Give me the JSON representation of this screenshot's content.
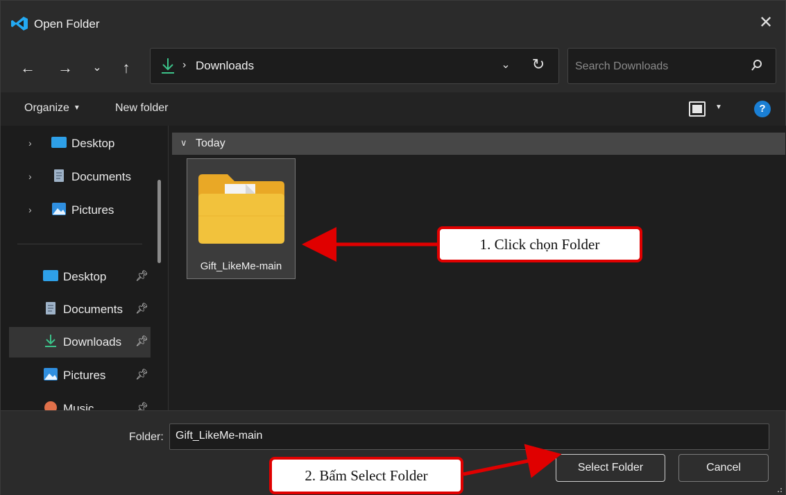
{
  "window": {
    "title": "Open Folder"
  },
  "nav": {
    "back_icon": "arrow-left-icon",
    "forward_icon": "arrow-right-icon",
    "recent_icon": "chevron-down-icon",
    "up_icon": "arrow-up-icon",
    "path_current": "Downloads",
    "refresh_icon": "refresh-icon",
    "search_placeholder": "Search Downloads"
  },
  "toolbar": {
    "organize_label": "Organize",
    "new_folder_label": "New folder",
    "help_label": "?"
  },
  "sidebar": {
    "tree": [
      {
        "label": "Desktop",
        "icon": "desktop-icon"
      },
      {
        "label": "Documents",
        "icon": "documents-icon"
      },
      {
        "label": "Pictures",
        "icon": "pictures-icon"
      }
    ],
    "quick_access": [
      {
        "label": "Desktop",
        "icon": "desktop-icon",
        "pinned": true
      },
      {
        "label": "Documents",
        "icon": "documents-icon",
        "pinned": true
      },
      {
        "label": "Downloads",
        "icon": "download-icon",
        "pinned": true,
        "selected": true
      },
      {
        "label": "Pictures",
        "icon": "pictures-icon",
        "pinned": true
      },
      {
        "label": "Music",
        "icon": "music-icon",
        "pinned": true
      }
    ]
  },
  "content": {
    "group_label": "Today",
    "items": [
      {
        "name": "Gift_LikeMe-main",
        "type": "folder",
        "selected": true
      }
    ]
  },
  "footer": {
    "folder_label": "Folder:",
    "folder_value": "Gift_LikeMe-main",
    "select_button": "Select Folder",
    "cancel_button": "Cancel"
  },
  "annotations": {
    "step1": "1. Click chọn Folder",
    "step2": "2. Bấm Select Folder",
    "arrow_color": "#e00000"
  },
  "colors": {
    "accent": "#1a7fd4",
    "download_green": "#3cc38a",
    "folder_yellow": "#f2c23c"
  }
}
